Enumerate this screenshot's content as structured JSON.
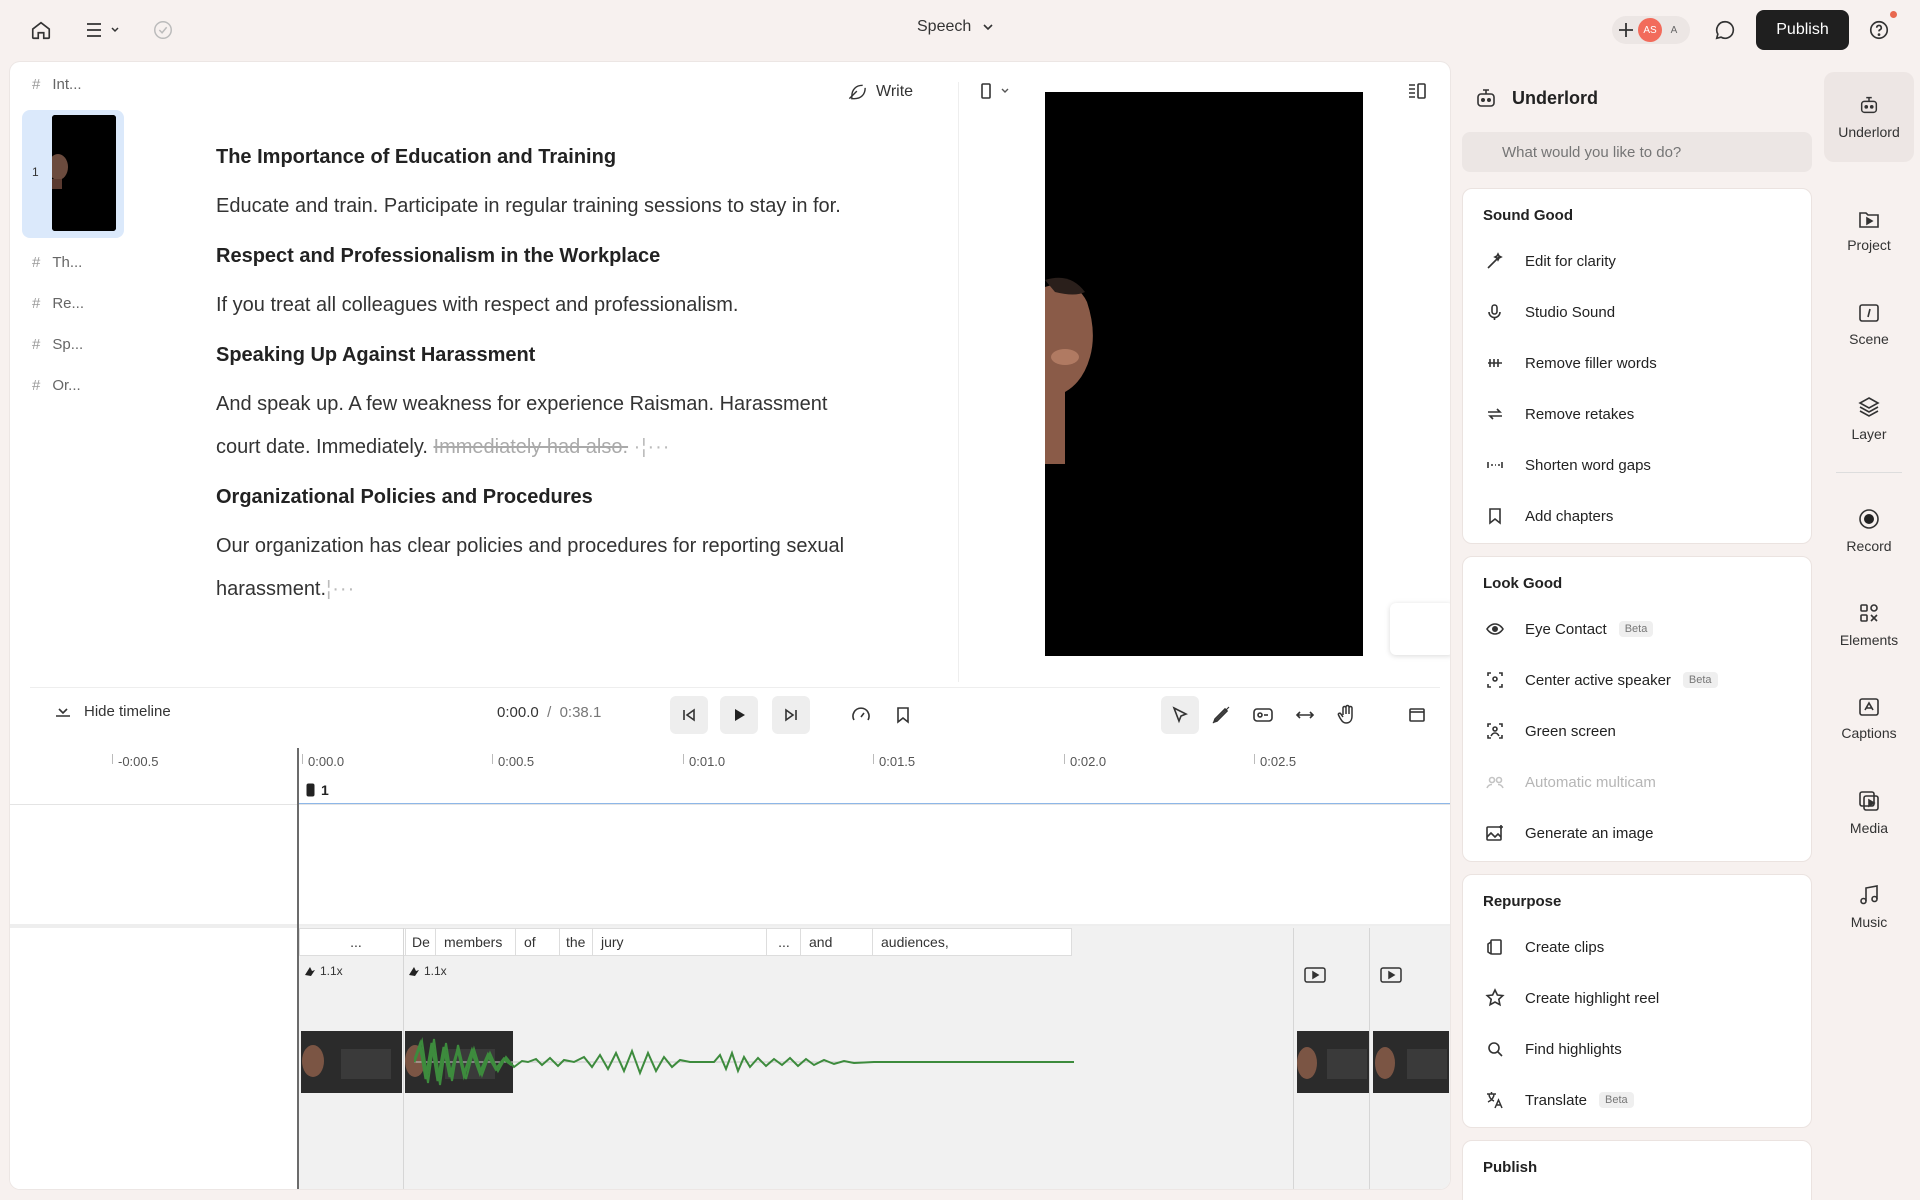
{
  "topbar": {
    "title": "Speech",
    "avatars": [
      "AS",
      "A"
    ],
    "publish_label": "Publish"
  },
  "scenes": {
    "items": [
      {
        "label": "Int..."
      },
      {
        "label": "Th..."
      },
      {
        "label": "Re..."
      },
      {
        "label": "Sp..."
      },
      {
        "label": "Or..."
      }
    ],
    "thumb_number": "1"
  },
  "editor": {
    "write_label": "Write",
    "script": {
      "h1": "The Importance of Education and Training",
      "p1": "Educate and train. Participate in regular training sessions to stay in for.",
      "h2": "Respect and Professionalism in the Workplace",
      "p2": "If you treat all colleagues with respect and professionalism.",
      "h3": "Speaking Up Against Harassment",
      "p3a": "And speak up. A few weakness for experience Raisman. Harassment",
      "p3b": "court date. Immediately.",
      "p3_struck": "Immediately had also.",
      "h4": "Organizational Policies and Procedures",
      "p4a": "Our organization has clear policies and procedures for reporting sexual",
      "p4b": "harassment."
    }
  },
  "transport": {
    "hide_timeline_label": "Hide timeline",
    "current_time": "0:00.0",
    "separator": "/",
    "duration": "0:38.1"
  },
  "timeline": {
    "ticks": [
      "-0:00.5",
      "0:00.0",
      "0:00.5",
      "0:01.0",
      "0:01.5",
      "0:02.0",
      "0:02.5"
    ],
    "scene_label": "1",
    "words": [
      "...",
      "De",
      "members",
      "of",
      "the",
      "jury",
      "...",
      "and",
      "audiences,"
    ],
    "speeds": [
      "1.1x",
      "1.1x"
    ]
  },
  "underlord": {
    "title": "Underlord",
    "search_placeholder": "What would you like to do?",
    "beta_label": "Beta",
    "sound_good": {
      "title": "Sound Good",
      "actions": [
        "Edit for clarity",
        "Studio Sound",
        "Remove filler words",
        "Remove retakes",
        "Shorten word gaps",
        "Add chapters"
      ]
    },
    "look_good": {
      "title": "Look Good",
      "actions": [
        "Eye Contact",
        "Center active speaker",
        "Green screen",
        "Automatic multicam",
        "Generate an image"
      ]
    },
    "repurpose": {
      "title": "Repurpose",
      "actions": [
        "Create clips",
        "Create highlight reel",
        "Find highlights",
        "Translate"
      ]
    },
    "publish": {
      "title": "Publish"
    }
  },
  "nav": {
    "items": [
      "Underlord",
      "Project",
      "Scene",
      "Layer",
      "Record",
      "Elements",
      "Captions",
      "Media",
      "Music"
    ]
  },
  "colors": {
    "accent_avatar": "#f26b5b",
    "waveform": "#3d8b3d",
    "scene_line": "#8db7e8",
    "selected_thumb": "#dbe9fb"
  }
}
